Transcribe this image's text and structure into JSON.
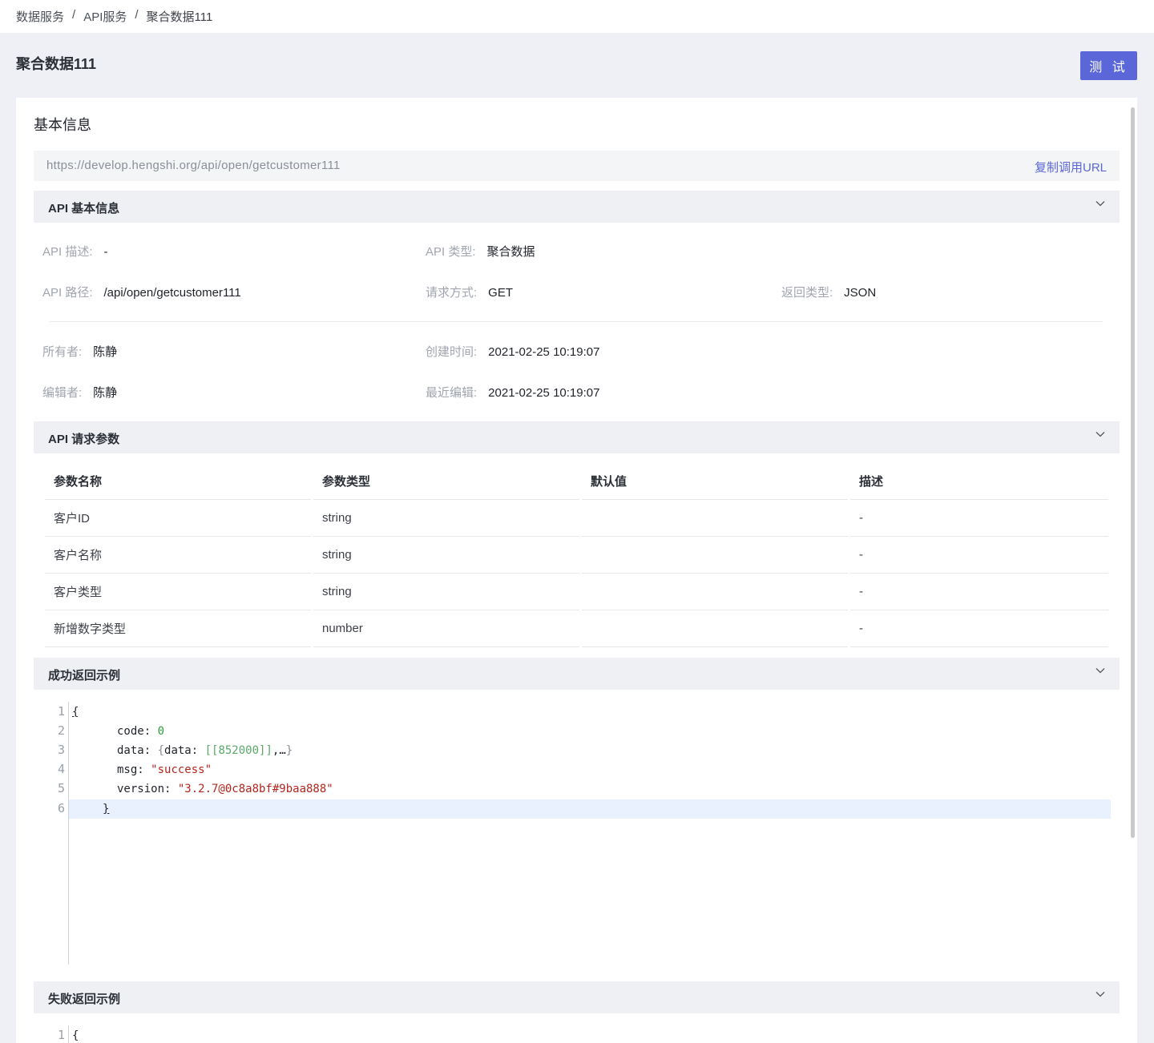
{
  "breadcrumb": [
    "数据服务",
    "API服务",
    "聚合数据111"
  ],
  "breadcrumb_sep": "/",
  "page_title": "聚合数据111",
  "test_button": "测 试",
  "card_title": "基本信息",
  "url": {
    "value": "https://develop.hengshi.org/api/open/getcustomer111",
    "copy_label": "复制调用URL"
  },
  "sections": {
    "basic": "API 基本信息",
    "params": "API 请求参数",
    "success": "成功返回示例",
    "fail": "失败返回示例"
  },
  "basic_info": {
    "desc": {
      "k": "API 描述:",
      "v": "-"
    },
    "type": {
      "k": "API 类型:",
      "v": "聚合数据"
    },
    "path": {
      "k": "API 路径:",
      "v": "/api/open/getcustomer111"
    },
    "method": {
      "k": "请求方式:",
      "v": "GET"
    },
    "return": {
      "k": "返回类型:",
      "v": "JSON"
    },
    "owner": {
      "k": "所有者:",
      "v": "陈静"
    },
    "created": {
      "k": "创建时间:",
      "v": "2021-02-25 10:19:07"
    },
    "editor": {
      "k": "编辑者:",
      "v": "陈静"
    },
    "edited": {
      "k": "最近编辑:",
      "v": "2021-02-25 10:19:07"
    }
  },
  "params_table": {
    "headers": [
      "参数名称",
      "参数类型",
      "默认值",
      "描述"
    ],
    "rows": [
      [
        "客户ID",
        "string",
        "",
        "-"
      ],
      [
        "客户名称",
        "string",
        "",
        "-"
      ],
      [
        "客户类型",
        "string",
        "",
        "-"
      ],
      [
        "新增数字类型",
        "number",
        "",
        "-"
      ]
    ]
  },
  "success_code": {
    "line_numbers": [
      "1",
      "2",
      "3",
      "4",
      "5",
      "6"
    ],
    "open": "{",
    "close": "}",
    "code_key": "code: ",
    "code_val": "0",
    "data_key": "data: ",
    "data_open": "{",
    "data_inner_key": "data: ",
    "data_inner_val": "[[852000]]",
    "data_rest": ",…",
    "data_close": "}",
    "msg_key": "msg: ",
    "msg_val": "\"success\"",
    "version_key": "version: ",
    "version_val": "\"3.2.7@0c8a8bf#9baa888\""
  },
  "fail_code": {
    "line_numbers": [
      "1"
    ],
    "open": "{"
  }
}
